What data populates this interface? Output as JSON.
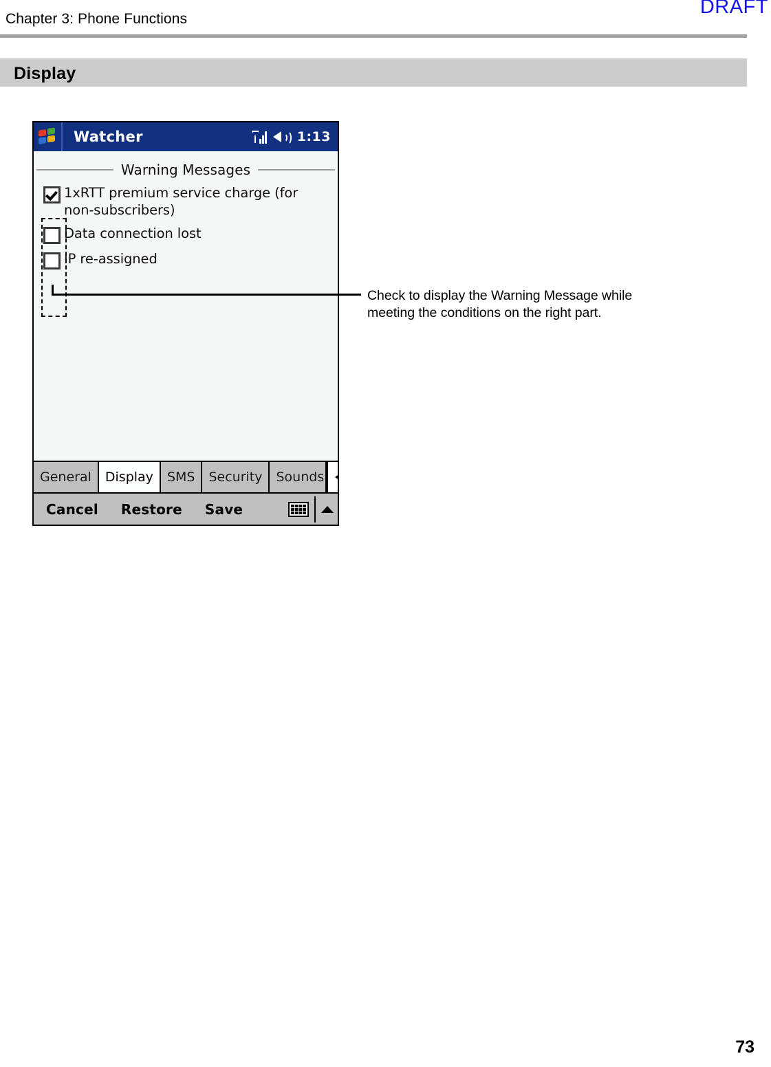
{
  "page": {
    "chapter_header": "Chapter 3: Phone Functions",
    "draft_watermark": "DRAFT",
    "section_title": "Display",
    "page_number": "73",
    "colors": {
      "draft": "#1414e6",
      "rule": "#a0a0a0",
      "banner": "#cccccc",
      "titlebar": "#11307f",
      "chrome": "#c0c0c0",
      "screen_bg": "#f4f8f4"
    }
  },
  "pda": {
    "titlebar": {
      "start_icon": "windows-flag-icon",
      "app_title": "Watcher",
      "signal_icon": "signal-strength-icon",
      "speaker_icon": "speaker-icon",
      "clock": "1:13"
    },
    "group": {
      "title": "Warning Messages"
    },
    "checkboxes": [
      {
        "label": "1xRTT premium service charge (for non-subscribers)",
        "checked": true
      },
      {
        "label": "Data connection lost",
        "checked": false
      },
      {
        "label": "IP re-assigned",
        "checked": false
      }
    ],
    "tabs": [
      {
        "label": "General",
        "active": false
      },
      {
        "label": "Display",
        "active": true
      },
      {
        "label": "SMS",
        "active": false
      },
      {
        "label": "Security",
        "active": false
      },
      {
        "label": "Sounds",
        "active": false
      }
    ],
    "tab_scroll": {
      "prev_icon": "triangle-left-icon",
      "next_icon": "triangle-right-icon"
    },
    "commandbar": {
      "buttons": [
        "Cancel",
        "Restore",
        "Save"
      ],
      "keyboard_icon": "keyboard-icon",
      "expand_icon": "triangle-up-icon"
    }
  },
  "annotation": {
    "text": "Check to display the Warning Message while meeting the conditions on the right part."
  }
}
